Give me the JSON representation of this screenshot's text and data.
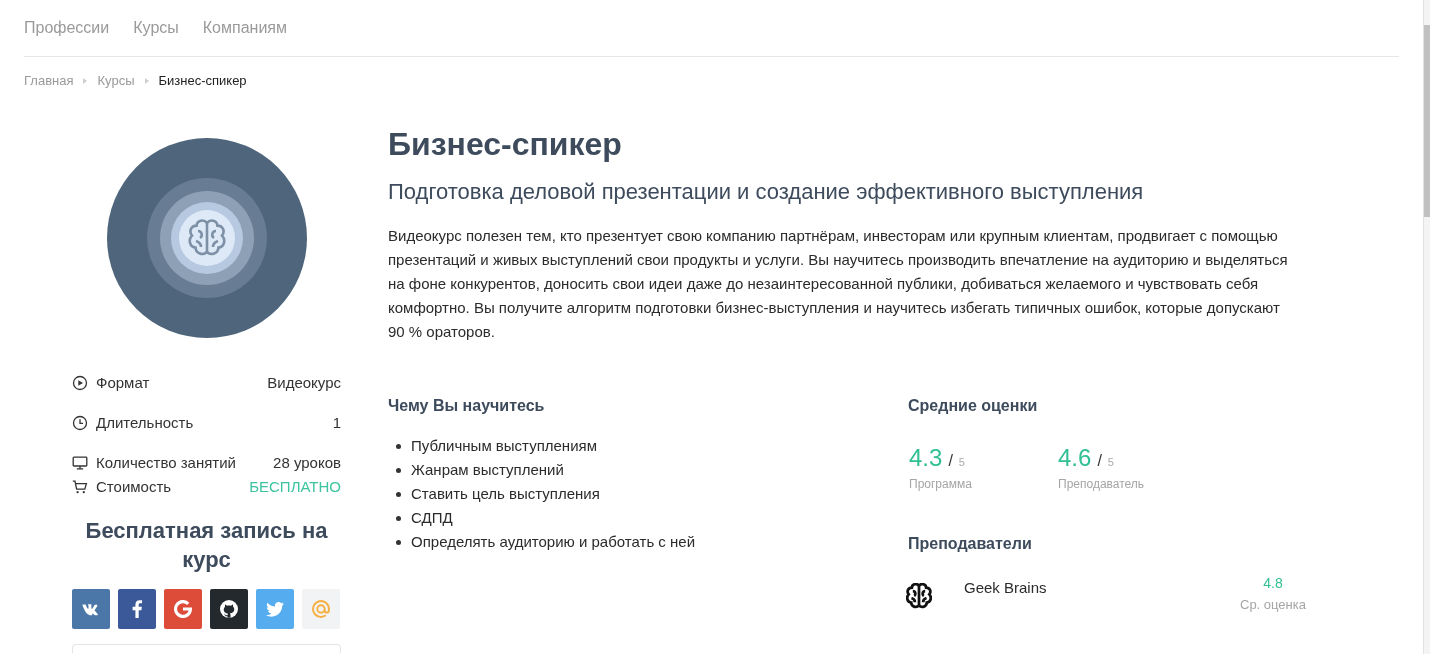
{
  "nav": [
    {
      "label": "Профессии"
    },
    {
      "label": "Курсы"
    },
    {
      "label": "Компаниям"
    }
  ],
  "breadcrumbs": [
    {
      "label": "Главная",
      "current": false
    },
    {
      "label": "Курсы",
      "current": false
    },
    {
      "label": "Бизнес-спикер",
      "current": true
    }
  ],
  "sidebar": {
    "info": [
      {
        "kind": "format",
        "label": "Формат",
        "value": "Видеокурс",
        "highlighted": false
      },
      {
        "kind": "duration",
        "label": "Длительность",
        "value": "1",
        "highlighted": false
      },
      {
        "kind": "lessons",
        "label": "Количество занятий",
        "value": "28 уроков",
        "highlighted": false
      },
      {
        "kind": "price",
        "label": "Стоимость",
        "value": "БЕСПЛАТНО",
        "highlighted": true
      }
    ],
    "signup": {
      "title": "Бесплатная запись на курс",
      "social_buttons": [
        {
          "kind": "vk"
        },
        {
          "kind": "facebook"
        },
        {
          "kind": "google"
        },
        {
          "kind": "github"
        },
        {
          "kind": "twitter"
        },
        {
          "kind": "mail"
        }
      ]
    }
  },
  "course": {
    "title": "Бизнес-спикер",
    "subtitle": "Подготовка деловой презентации и создание эффективного выступления",
    "description": "Видеокурс полезен тем, кто презентует свою компанию партнёрам, инвесторам или крупным клиентам, продвигает с помощью презентаций и живых выступлений свои продукты и услуги. Вы научитесь производить впечатление на аудиторию и выделяться на фоне конкурентов, доносить свои идеи даже до незаинтересованной публики, добиваться желаемого и чувствовать себя комфортно. Вы получите алгоритм подготовки бизнес-выступления и научитесь избегать типичных ошибок, которые допускают 90 % ораторов."
  },
  "learn": {
    "heading": "Чему Вы научитесь",
    "items": [
      "Публичным выступлениям",
      "Жанрам выступлений",
      "Ставить цель выступления",
      "СДПД",
      "Определять аудиторию и работать с ней"
    ]
  },
  "ratings": {
    "heading": "Средние оценки",
    "items": [
      {
        "score": "4.3",
        "slash": "/",
        "max": "5",
        "label": "Программа"
      },
      {
        "score": "4.6",
        "slash": "/",
        "max": "5",
        "label": "Преподаватель"
      }
    ]
  },
  "teachers": {
    "heading": "Преподаватели",
    "items": [
      {
        "name": "Geek Brains",
        "rating": "4.8",
        "rating_label": "Ср. оценка"
      }
    ]
  }
}
